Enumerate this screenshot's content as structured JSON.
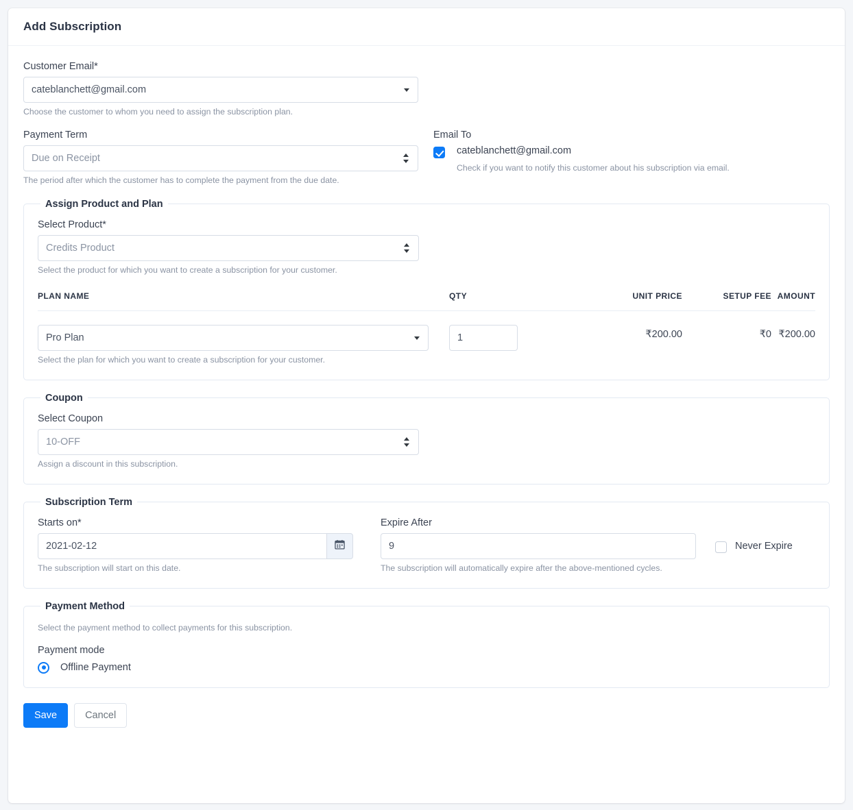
{
  "page": {
    "title": "Add Subscription"
  },
  "customer": {
    "label": "Customer Email*",
    "value": "cateblanchett@gmail.com",
    "hint": "Choose the customer to whom you need to assign the subscription plan."
  },
  "payment_term": {
    "label": "Payment Term",
    "value": "Due on Receipt",
    "hint": "The period after which the customer has to complete the payment from the due date."
  },
  "email_to": {
    "label": "Email To",
    "checked": true,
    "email": "cateblanchett@gmail.com",
    "hint": "Check if you want to notify this customer about his subscription via email."
  },
  "assign_product": {
    "legend": "Assign Product and Plan",
    "product_label": "Select Product*",
    "product_value": "Credits Product",
    "product_hint": "Select the product for which you want to create a subscription for your customer.",
    "table": {
      "headers": [
        "PLAN NAME",
        "QTY",
        "UNIT PRICE",
        "SETUP FEE",
        "AMOUNT"
      ],
      "row": {
        "plan_name": "Pro Plan",
        "qty": "1",
        "unit_price": "₹200.00",
        "setup_fee": "₹0",
        "amount": "₹200.00"
      },
      "plan_hint": "Select the plan for which you want to create a subscription for your customer."
    }
  },
  "coupon": {
    "legend": "Coupon",
    "label": "Select Coupon",
    "value": "10-OFF",
    "hint": "Assign a discount in this subscription."
  },
  "subscription_term": {
    "legend": "Subscription Term",
    "starts_on_label": "Starts on*",
    "starts_on_value": "2021-02-12",
    "starts_on_hint": "The subscription will start on this date.",
    "expire_after_label": "Expire After",
    "expire_after_value": "9",
    "expire_after_hint": "The subscription will automatically expire after the above-mentioned cycles.",
    "never_expire_label": "Never Expire",
    "never_expire_checked": false
  },
  "payment_method": {
    "legend": "Payment Method",
    "description": "Select the payment method to collect payments for this subscription.",
    "mode_label": "Payment mode",
    "option_label": "Offline Payment",
    "option_selected": true
  },
  "footer": {
    "save_label": "Save",
    "cancel_label": "Cancel"
  },
  "colors": {
    "accent": "#0d7bf7",
    "page_bg": "#f4f6f9",
    "border": "#d7dde6",
    "hint_text": "#8a93a3"
  }
}
